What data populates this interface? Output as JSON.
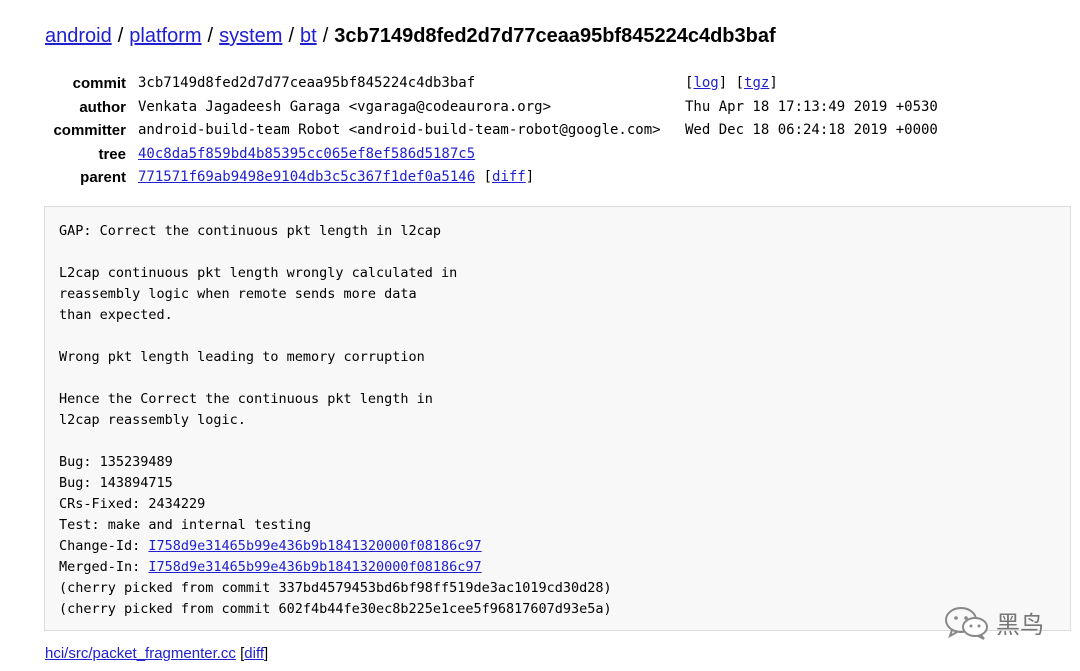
{
  "breadcrumb": {
    "items": [
      "android",
      "platform",
      "system",
      "bt"
    ],
    "separator": "/",
    "current": "3cb7149d8fed2d7d77ceaa95bf845224c4db3baf"
  },
  "meta": {
    "commit": {
      "label": "commit",
      "value": "3cb7149d8fed2d7d77ceaa95bf845224c4db3baf",
      "log": "log",
      "tgz": "tgz"
    },
    "author": {
      "label": "author",
      "value": "Venkata Jagadeesh Garaga <vgaraga@codeaurora.org>",
      "date": "Thu Apr 18 17:13:49 2019 +0530"
    },
    "committer": {
      "label": "committer",
      "value": "android-build-team Robot <android-build-team-robot@google.com>",
      "date": "Wed Dec 18 06:24:18 2019 +0000"
    },
    "tree": {
      "label": "tree",
      "value": "40c8da5f859bd4b85395cc065ef8ef586d5187c5"
    },
    "parent": {
      "label": "parent",
      "value": "771571f69ab9498e9104db3c5c367f1def0a5146",
      "diff": "diff"
    }
  },
  "message": {
    "body": "GAP: Correct the continuous pkt length in l2cap\n\nL2cap continuous pkt length wrongly calculated in\nreassembly logic when remote sends more data\nthan expected.\n\nWrong pkt length leading to memory corruption\n\nHence the Correct the continuous pkt length in\nl2cap reassembly logic.\n\nBug: 135239489\nBug: 143894715\nCRs-Fixed: 2434229\nTest: make and internal testing",
    "change_id_label": "Change-Id: ",
    "change_id": "I758d9e31465b99e436b9b1841320000f08186c97",
    "merged_in_label": "Merged-In: ",
    "merged_in": "I758d9e31465b99e436b9b1841320000f08186c97",
    "cherry1": "(cherry picked from commit 337bd4579453bd6bf98ff519de3ac1019cd30d28)",
    "cherry2": "(cherry picked from commit 602f4b44fe30ec8b225e1cee5f96817607d93e5a)"
  },
  "files": {
    "path": "hci/src/packet_fragmenter.cc",
    "diff": "diff"
  },
  "watermark": {
    "text": "黑鸟",
    "icon": "wechat-icon"
  }
}
